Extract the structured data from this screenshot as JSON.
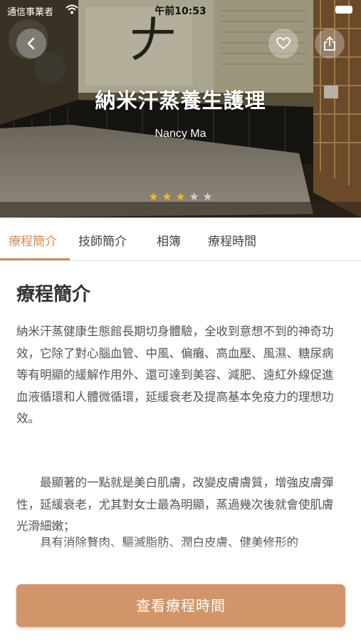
{
  "status_bar": {
    "carrier": "通信事業者",
    "time": "午前10:53"
  },
  "hero": {
    "title": "納米汗蒸養生護理",
    "therapist": "Nancy Ma",
    "rating": 3,
    "rating_max": 5,
    "icons": {
      "back": "chevron-left-icon",
      "favorite": "heart-icon",
      "share": "share-icon"
    }
  },
  "tabs": [
    {
      "label": "療程簡介",
      "active": true
    },
    {
      "label": "技師簡介",
      "active": false
    },
    {
      "label": "相簿",
      "active": false
    },
    {
      "label": "療程時間",
      "active": false
    }
  ],
  "content": {
    "title": "療程簡介",
    "paragraphs": [
      "納米汗蒸健康生態館長期切身體驗，全收到意想不到的神奇功效，它除了對心腦血管、中風、偏癱、高血壓、風濕、糖尿病等有明顯的緩解作用外、還可達到美容、減肥、遠紅外線促進血液循環和人體微循環，延緩衰老及提高基本免疫力的理想功效。",
      "最顯著的一點就是美白肌膚，改變皮膚膚質，增強皮膚彈性，延緩衰老，尤其對女士最為明顯，蒸過幾次後就會使肌膚光滑細嫩；",
      "具有消除贅肉、驅滅脂肪、潤白皮膚、健美修形的"
    ]
  },
  "cta": {
    "label": "查看療程時間"
  },
  "colors": {
    "accent": "#d88a52",
    "button": "#d29569",
    "star_on": "#f4b52a",
    "star_off": "#cfcfcf"
  }
}
